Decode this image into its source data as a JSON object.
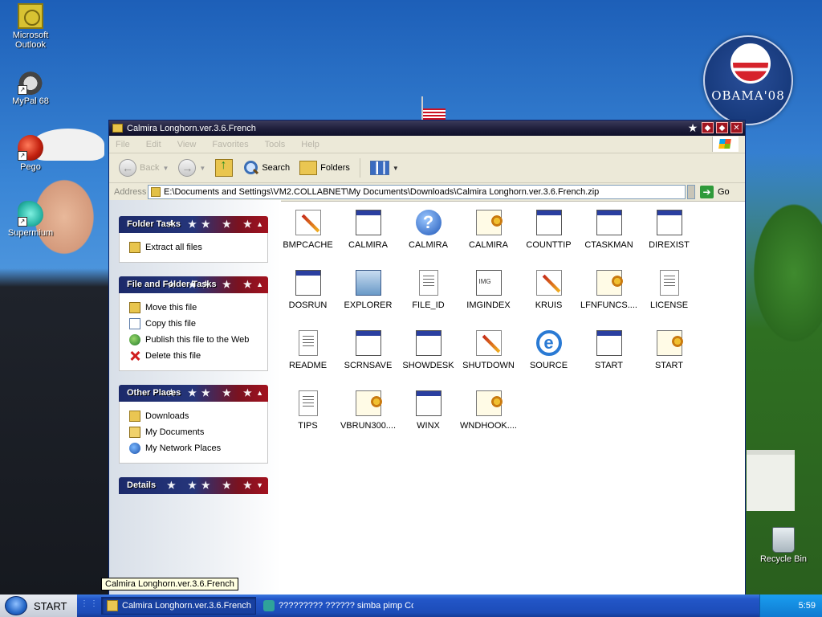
{
  "desktop": {
    "icons": [
      {
        "label": "Microsoft Outlook"
      },
      {
        "label": "MyPal 68"
      },
      {
        "label": "Pego"
      },
      {
        "label": "Supermium"
      }
    ],
    "recycle_bin": "Recycle Bin",
    "logo_text": "OBAMA'08"
  },
  "window": {
    "title": "Calmira Longhorn.ver.3.6.French",
    "menu": [
      "File",
      "Edit",
      "View",
      "Favorites",
      "Tools",
      "Help"
    ],
    "toolbar": {
      "back": "Back",
      "search": "Search",
      "folders": "Folders"
    },
    "address": {
      "label": "Address",
      "value": "E:\\Documents and Settings\\VM2.COLLABNET\\My Documents\\Downloads\\Calmira Longhorn.ver.3.6.French.zip",
      "go": "Go"
    },
    "panels": [
      {
        "title": "Folder Tasks",
        "items": [
          "Extract all files"
        ]
      },
      {
        "title": "File and Folder Tasks",
        "items": [
          "Move this file",
          "Copy this file",
          "Publish this file to the Web",
          "Delete this file"
        ]
      },
      {
        "title": "Other Places",
        "items": [
          "Downloads",
          "My Documents",
          "My Network Places"
        ]
      },
      {
        "title": "Details",
        "items": []
      }
    ],
    "files": [
      {
        "name": "BMPCACHE",
        "icon": "paint"
      },
      {
        "name": "CALMIRA",
        "icon": "app"
      },
      {
        "name": "CALMIRA",
        "icon": "help"
      },
      {
        "name": "CALMIRA",
        "icon": "config"
      },
      {
        "name": "COUNTTIP",
        "icon": "app"
      },
      {
        "name": "CTASKMAN",
        "icon": "app"
      },
      {
        "name": "DIREXIST",
        "icon": "app"
      },
      {
        "name": "DOSRUN",
        "icon": "app"
      },
      {
        "name": "EXPLORER",
        "icon": "explorer"
      },
      {
        "name": "FILE_ID",
        "icon": "text"
      },
      {
        "name": "IMGINDEX",
        "icon": "image"
      },
      {
        "name": "KRUIS",
        "icon": "paint"
      },
      {
        "name": "LFNFUNCS....",
        "icon": "config"
      },
      {
        "name": "LICENSE",
        "icon": "text"
      },
      {
        "name": "README",
        "icon": "text"
      },
      {
        "name": "SCRNSAVE",
        "icon": "app"
      },
      {
        "name": "SHOWDESK",
        "icon": "app"
      },
      {
        "name": "SHUTDOWN",
        "icon": "paint"
      },
      {
        "name": "SOURCE",
        "icon": "ie"
      },
      {
        "name": "START",
        "icon": "app"
      },
      {
        "name": "START",
        "icon": "config"
      },
      {
        "name": "TIPS",
        "icon": "text"
      },
      {
        "name": "VBRUN300....",
        "icon": "config"
      },
      {
        "name": "WINX",
        "icon": "app"
      },
      {
        "name": "WNDHOOK....",
        "icon": "config"
      }
    ]
  },
  "tooltip": "Calmira Longhorn.ver.3.6.French",
  "taskbar": {
    "start": "START",
    "tasks": [
      {
        "label": "Calmira Longhorn.ver.3.6.French",
        "active": true
      },
      {
        "label": "????????? ?????? simba pimp Con...",
        "active": false
      }
    ],
    "clock": "5:59"
  }
}
